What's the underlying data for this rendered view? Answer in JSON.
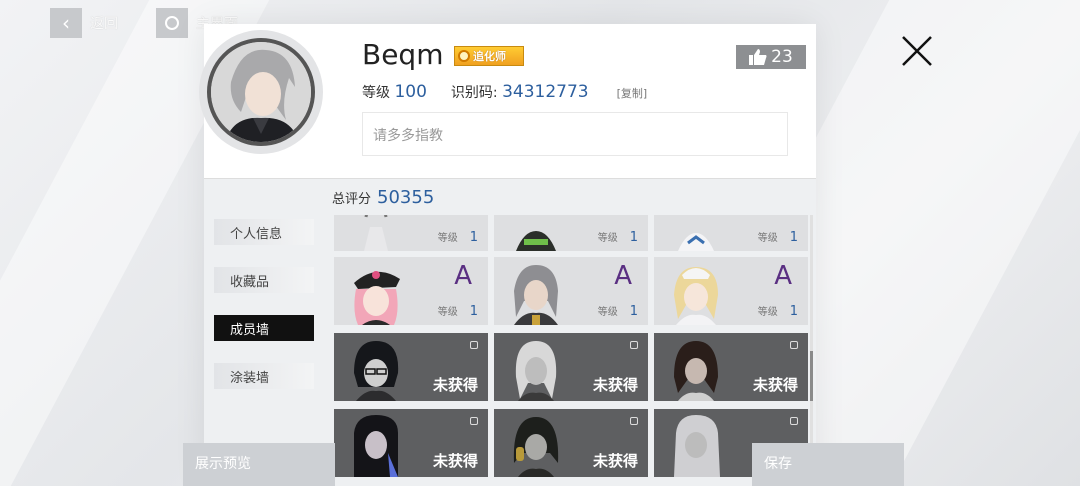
{
  "top": {
    "back_label": "返回",
    "home_label": "主界面"
  },
  "profile": {
    "name": "Beqm",
    "title_badge": "追化师",
    "likes": "23",
    "level_label": "等级",
    "level_value": "100",
    "id_label": "识别码:",
    "id_value": "34312773",
    "copy_label": "[复制]",
    "motto": "请多多指教"
  },
  "panel": {
    "score_label": "总评分",
    "score_value": "50355",
    "tabs": [
      {
        "label": "个人信息"
      },
      {
        "label": "收藏品"
      },
      {
        "label": "成员墙"
      },
      {
        "label": "涂装墙"
      }
    ],
    "active_tab": "成员墙",
    "level_label": "等级",
    "unobtained_label": "未获得",
    "rank_letter": "A",
    "level_one": "1"
  },
  "bottom": {
    "left_label": "展示预览",
    "right_label": "保存"
  },
  "colors": {
    "accent_blue": "#2d5f9e",
    "rank_purple": "#5a2f82",
    "locked_bg": "#5e5f61"
  }
}
